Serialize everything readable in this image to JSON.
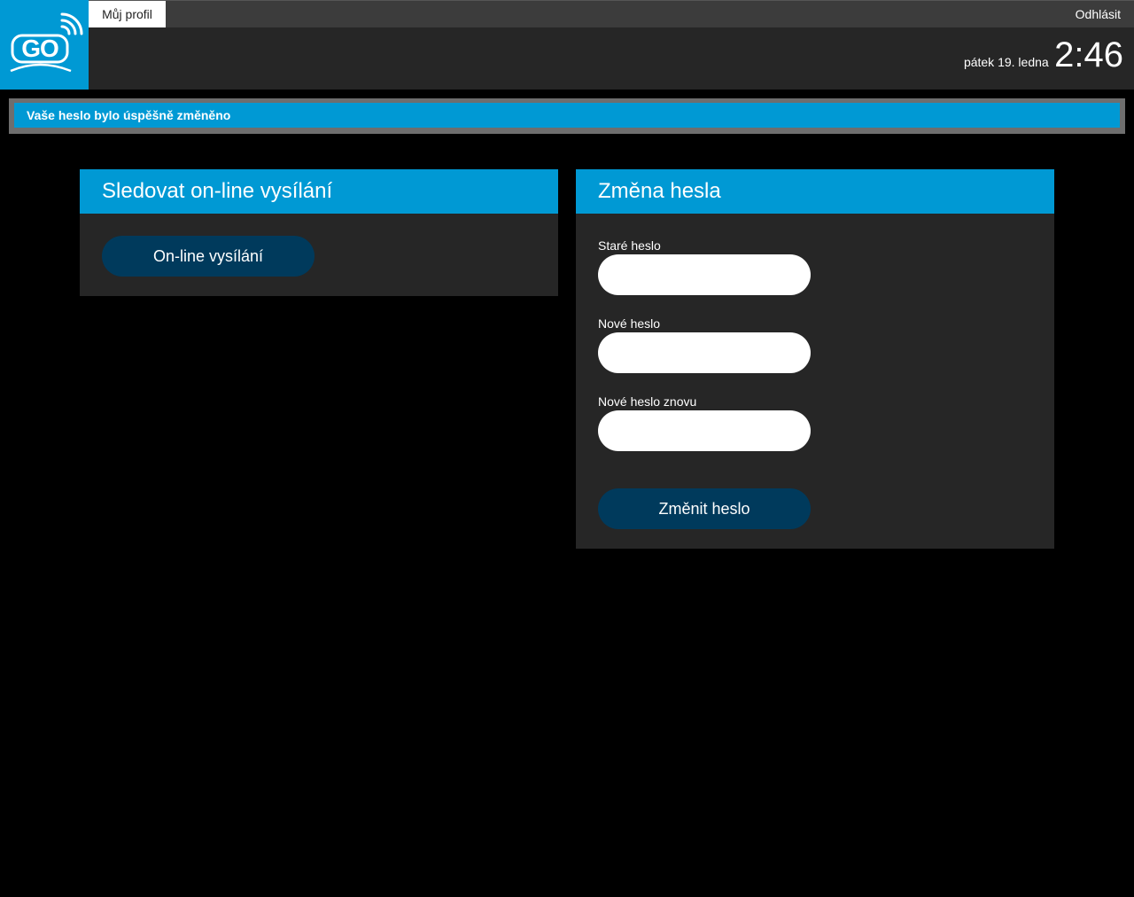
{
  "header": {
    "logo_text": "GO",
    "tab_profile": "Můj profil",
    "logout": "Odhlásit",
    "date": "pátek 19. ledna",
    "time": "2:46",
    "colors": {
      "brand": "#0099d4",
      "topbar": "#3c3c3c",
      "header": "#262626"
    }
  },
  "notice": {
    "text": "Vaše heslo bylo úspěšně změněno"
  },
  "live_panel": {
    "title": "Sledovat on-line vysílání",
    "button": "On-line vysílání"
  },
  "password_panel": {
    "title": "Změna hesla",
    "fields": [
      {
        "label": "Staré heslo",
        "value": ""
      },
      {
        "label": "Nové heslo",
        "value": ""
      },
      {
        "label": "Nové heslo znovu",
        "value": ""
      }
    ],
    "submit": "Změnit heslo"
  },
  "icons": [
    "wifi-signal-icon"
  ]
}
